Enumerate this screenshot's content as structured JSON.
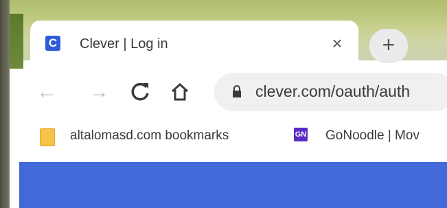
{
  "tab": {
    "favicon_letter": "C",
    "title": "Clever | Log in",
    "close_glyph": "×"
  },
  "new_tab": {
    "glyph": "+"
  },
  "toolbar": {
    "back_glyph": "←",
    "forward_glyph": "→",
    "reload_glyph": "C",
    "url": "clever.com/oauth/auth"
  },
  "bookmarks": [
    {
      "label": "altalomasd.com bookmarks",
      "icon": "folder-icon"
    },
    {
      "label": "GoNoodle | Mov",
      "icon": "gonoodle-icon",
      "icon_text": "GN"
    }
  ],
  "colors": {
    "page_accent": "#4169d8",
    "favicon_bg": "#2f5ad8",
    "gonoodle_bg": "#5a2bc6"
  }
}
